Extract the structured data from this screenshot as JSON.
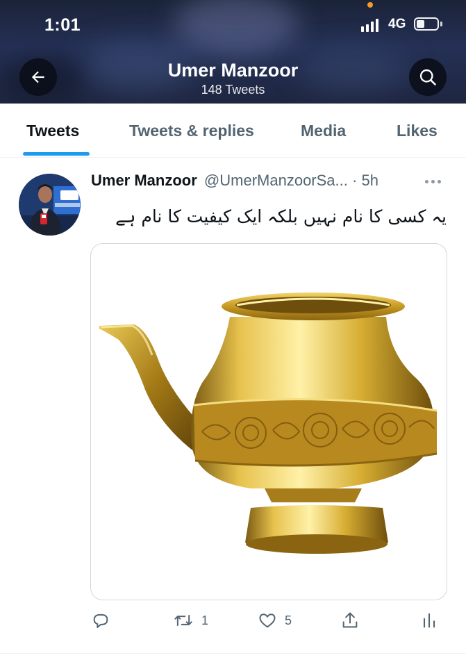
{
  "status_bar": {
    "time": "1:01",
    "network": "4G"
  },
  "header": {
    "name": "Umer Manzoor",
    "tweet_count": "148 Tweets",
    "back_icon": "arrow-left-icon",
    "search_icon": "search-icon"
  },
  "tabs": [
    {
      "label": "Tweets",
      "active": true
    },
    {
      "label": "Tweets & replies",
      "active": false
    },
    {
      "label": "Media",
      "active": false
    },
    {
      "label": "Likes",
      "active": false
    }
  ],
  "tweet": {
    "author": "Umer Manzoor",
    "handle": "@UmerManzoorSa...",
    "separator": "·",
    "time": "5h",
    "text": "یہ کسی کا نام نہیں بلکہ ایک کیفیت کا نام ہے",
    "reply_count": "",
    "retweet_count": "1",
    "like_count": "5"
  },
  "colors": {
    "accent": "#1d9bf0",
    "text_primary": "#0f1419",
    "text_secondary": "#536471",
    "brass": "#c9a227"
  }
}
